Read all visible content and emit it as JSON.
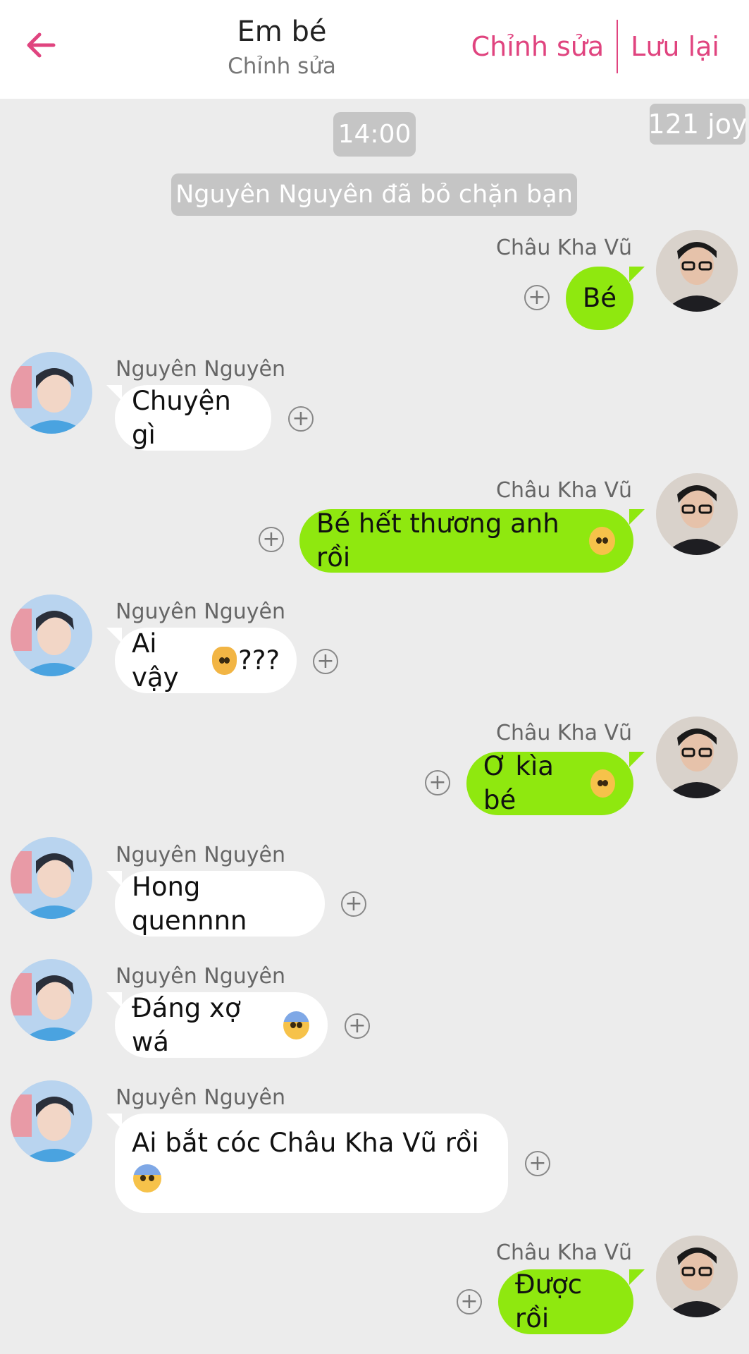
{
  "header": {
    "title": "Em bé",
    "subtitle": "Chỉnh sửa",
    "edit_label": "Chỉnh sửa",
    "save_label": "Lưu lại",
    "accent_color": "#e0447f"
  },
  "corner_badge": "121 joy",
  "timestamp": "14:00",
  "system_note": "Nguyên Nguyên đã bỏ chặn bạn",
  "messages": [
    {
      "sender": "Châu Kha Vũ",
      "side": "me",
      "text": "Bé"
    },
    {
      "sender": "Nguyên Nguyên",
      "side": "them",
      "text": "Chuyện gì"
    },
    {
      "sender": "Châu Kha Vũ",
      "side": "me",
      "text": "Bé hết thương anh rồi",
      "emoji": "pleading-face"
    },
    {
      "sender": "Nguyên Nguyên",
      "side": "them",
      "text": "Ai vậy",
      "emoji": "weary-cat",
      "text_after": "???"
    },
    {
      "sender": "Châu Kha Vũ",
      "side": "me",
      "text": "Ơ kìa bé",
      "emoji": "pleading-face"
    },
    {
      "sender": "Nguyên Nguyên",
      "side": "them",
      "text": "Hong quennnn"
    },
    {
      "sender": "Nguyên Nguyên",
      "side": "them",
      "text": "Đáng xợ wá",
      "emoji": "anxious-face-with-sweat"
    },
    {
      "sender": "Nguyên Nguyên",
      "side": "them",
      "text": "Ai bắt cóc Châu Kha Vũ rồi",
      "emoji": "anxious-face-with-sweat"
    },
    {
      "sender": "Châu Kha Vũ",
      "side": "me",
      "text": "Được rồi"
    }
  ],
  "colors": {
    "my_bubble": "#8fe80f",
    "their_bubble": "#ffffff",
    "background": "#ececec",
    "pill": "#c5c5c5"
  }
}
